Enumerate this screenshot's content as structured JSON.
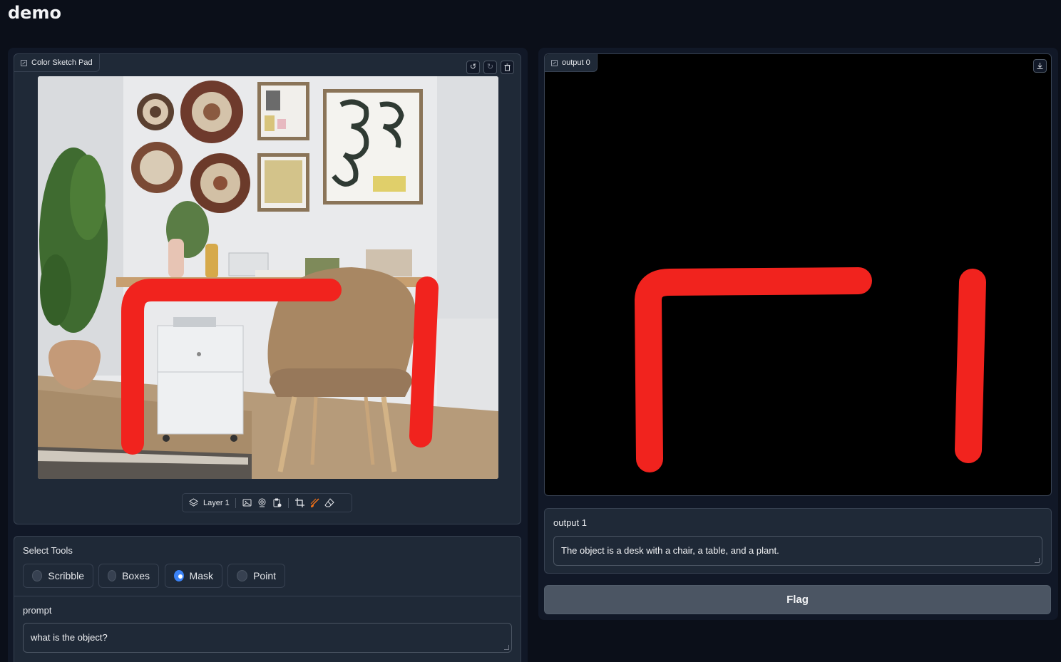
{
  "app": {
    "title": "demo"
  },
  "sketch_pad": {
    "label": "Color Sketch Pad",
    "layer_label": "Layer 1",
    "icons": [
      "image-icon",
      "undo-icon",
      "redo-icon",
      "trash-icon",
      "layers-icon",
      "upload-image-icon",
      "webcam-icon",
      "paste-icon",
      "crop-icon",
      "brush-icon",
      "eraser-icon"
    ]
  },
  "tools": {
    "label": "Select Tools",
    "options": [
      "Scribble",
      "Boxes",
      "Mask",
      "Point"
    ],
    "selected": "Mask"
  },
  "prompt": {
    "label": "prompt",
    "value": "what is the object?"
  },
  "output0": {
    "label": "output 0"
  },
  "output1": {
    "label": "output 1",
    "value": "The object is a desk with a chair, a table, and a plant."
  },
  "flag": {
    "label": "Flag"
  },
  "colors": {
    "background": "#0b0f19",
    "panel": "#1f2937",
    "stroke": "#f1231e",
    "accent": "#3b82f6"
  }
}
